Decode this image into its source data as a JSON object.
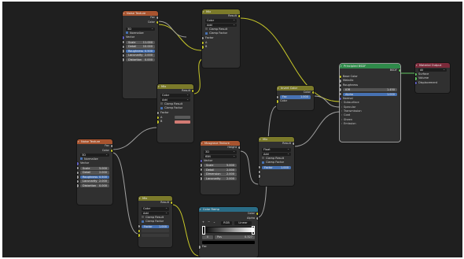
{
  "nodes": {
    "noise1": {
      "title": "Noise Texture",
      "out_fac": "Fac",
      "out_color": "Color",
      "dimension": "3D",
      "normalize": "Normalize",
      "in_vector": "Vector",
      "fields": [
        {
          "label": "Scale",
          "value": "11.000"
        },
        {
          "label": "Detail",
          "value": "10.000"
        },
        {
          "label": "Roughness",
          "value": "0.500"
        },
        {
          "label": "Lacunarity",
          "value": "2.000"
        },
        {
          "label": "Distortion",
          "value": "0.000"
        }
      ]
    },
    "mix_top": {
      "title": "Mix",
      "out_result": "Result",
      "type": "Color",
      "blend": "Add",
      "clamp_result": "Clamp Result",
      "clamp_factor": "Clamp Factor",
      "in_factor": "Factor",
      "in_a": "A",
      "in_b": "B"
    },
    "mix_mid": {
      "title": "Mix",
      "out_result": "Result",
      "type": "Color",
      "blend": "Add",
      "clamp_result": "Clamp Result",
      "clamp_factor": "Clamp Factor",
      "in_factor": "Factor",
      "in_a": "A",
      "in_b": "B"
    },
    "invert": {
      "title": "Invert Color",
      "out_color": "Color",
      "in_fac_label": "Fac",
      "in_fac_value": "1.000",
      "in_color": "Color"
    },
    "bsdf": {
      "title": "Principled BSDF",
      "out": "BSDF",
      "base_color": "Base Color",
      "metallic": "Metallic",
      "roughness": "Roughness",
      "ior_label": "IOR",
      "ior_value": "1.450",
      "alpha_label": "Alpha",
      "alpha_value": "1.000",
      "normal": "Normal",
      "subs": [
        "Subsurface",
        "Specular",
        "Transmission",
        "Coat",
        "Sheen",
        "Emission"
      ]
    },
    "output": {
      "title": "Material Output",
      "target": "All",
      "surface": "Surface",
      "volume": "Volume",
      "displacement": "Displacement"
    },
    "noise2": {
      "title": "Noise Texture",
      "out_fac": "Fac",
      "out_color": "Color",
      "dimension": "3D",
      "normalize": "Normalize",
      "in_vector": "Vector",
      "fields": [
        {
          "label": "Scale",
          "value": "5.000"
        },
        {
          "label": "Detail",
          "value": "2.000"
        },
        {
          "label": "Roughness",
          "value": "0.500"
        },
        {
          "label": "Lacunarity",
          "value": "2.000"
        },
        {
          "label": "Distortion",
          "value": "0.000"
        }
      ]
    },
    "musgrave": {
      "title": "Musgrave Texture",
      "out_height": "Height",
      "dimension": "3D",
      "type": "fBM",
      "in_vector": "Vector",
      "fields": [
        {
          "label": "Scale",
          "value": "5.000"
        },
        {
          "label": "Detail",
          "value": "2.000"
        },
        {
          "label": "Dimension",
          "value": "2.000"
        },
        {
          "label": "Lacunarity",
          "value": "2.000"
        }
      ]
    },
    "mix_right": {
      "title": "Mix",
      "out_result": "Result",
      "type": "Float",
      "blend": "Add",
      "clamp_result": "Clamp Result",
      "clamp_factor": "Clamp Factor",
      "factor_label": "Factor",
      "factor_value": "1.000"
    },
    "mix_bot": {
      "title": "Mix",
      "out_result": "Result",
      "type": "Color",
      "blend": "Add",
      "clamp_result": "Clamp Result",
      "clamp_factor": "Clamp Factor",
      "factor_label": "Factor",
      "factor_value": "1.000"
    },
    "ramp": {
      "title": "Color Ramp",
      "out_color": "Color",
      "out_alpha": "Alpha",
      "color_mode": "RGB",
      "interp": "Linear",
      "stop_index": "0",
      "pos_label": "Pos",
      "pos_value": "0.327",
      "in_fac": "Fac"
    }
  },
  "colors": {
    "wire_yellow": "#c7c729",
    "wire_gray": "#a1a1a1",
    "wire_green": "#63c763",
    "accent_blue": "#4772b3",
    "invert_swatch": "#d27b74"
  }
}
